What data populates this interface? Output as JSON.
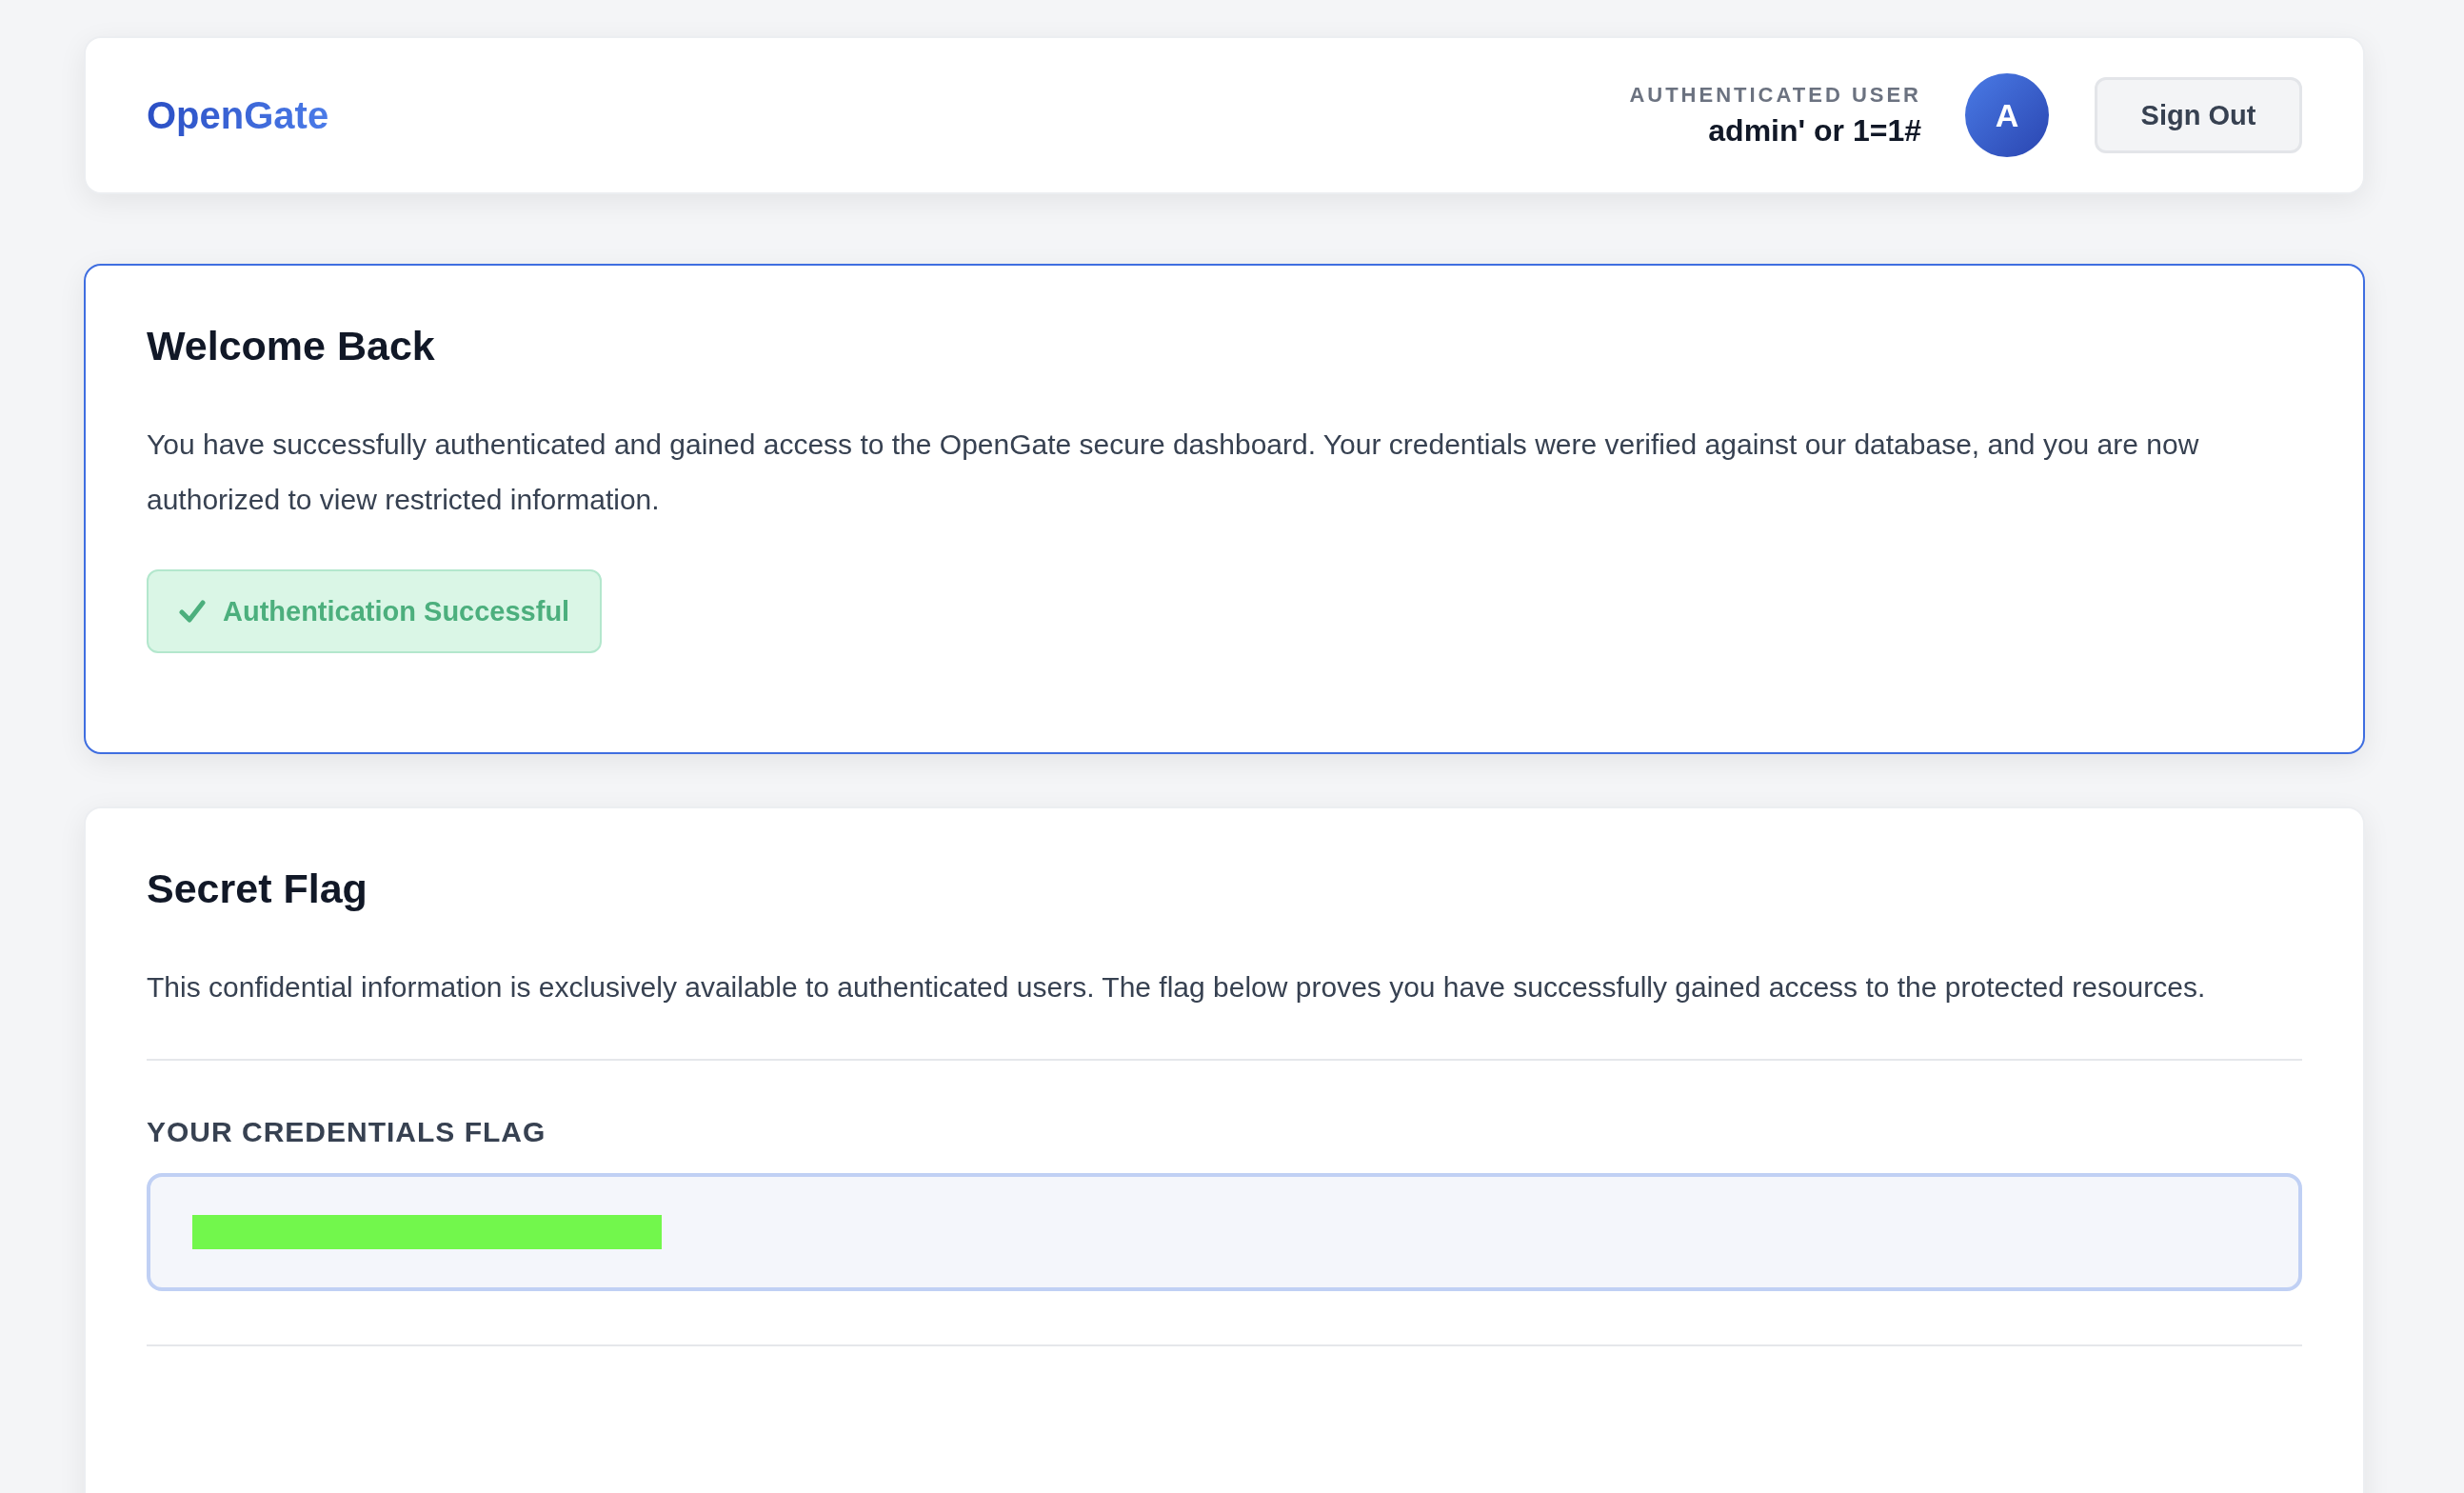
{
  "header": {
    "logo": "OpenGate",
    "user_label": "AUTHENTICATED USER",
    "username": "admin' or 1=1#",
    "avatar_initial": "A",
    "sign_out": "Sign Out"
  },
  "welcome": {
    "title": "Welcome Back",
    "text": "You have successfully authenticated and gained access to the OpenGate secure dashboard. Your credentials were verified against our database, and you are now authorized to view restricted information.",
    "status": "Authentication Successful"
  },
  "secret": {
    "title": "Secret Flag",
    "text": "This confidential information is exclusively available to authenticated users. The flag below proves you have successfully gained access to the protected resources.",
    "flag_label": "YOUR CREDENTIALS FLAG",
    "flag_redacted": true
  }
}
